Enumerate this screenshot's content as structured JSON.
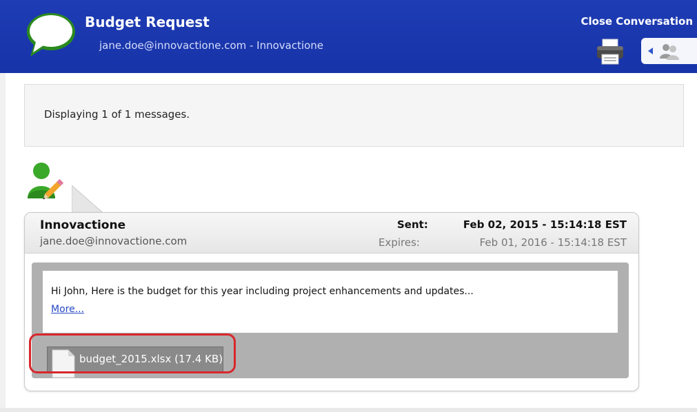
{
  "header": {
    "title": "Budget Request",
    "subtitle": "jane.doe@innovactione.com - Innovactione",
    "close_label": "Close Conversation",
    "icons": [
      "speech-bubble-icon",
      "printer-icon",
      "arrow-left-icon",
      "people-icon"
    ]
  },
  "status": {
    "text": "Displaying 1 of 1 messages."
  },
  "message": {
    "sender_name": "Innovactione",
    "sender_email": "jane.doe@innovactione.com",
    "sent_label": "Sent:",
    "sent_value": "Feb 02, 2015 - 15:14:18 EST",
    "expires_label": "Expires:",
    "expires_value": "Feb 01, 2016 - 15:14:18 EST",
    "body": "Hi John,  Here is the budget for this year including project enhancements and updates...",
    "more_link": "More...",
    "attachment": "budget_2015.xlsx (17.4 KB)"
  },
  "colors": {
    "header_bg": "#1e3cb4",
    "accent_green": "#3aa829",
    "highlight": "#d9262b",
    "link": "#2648c4"
  }
}
